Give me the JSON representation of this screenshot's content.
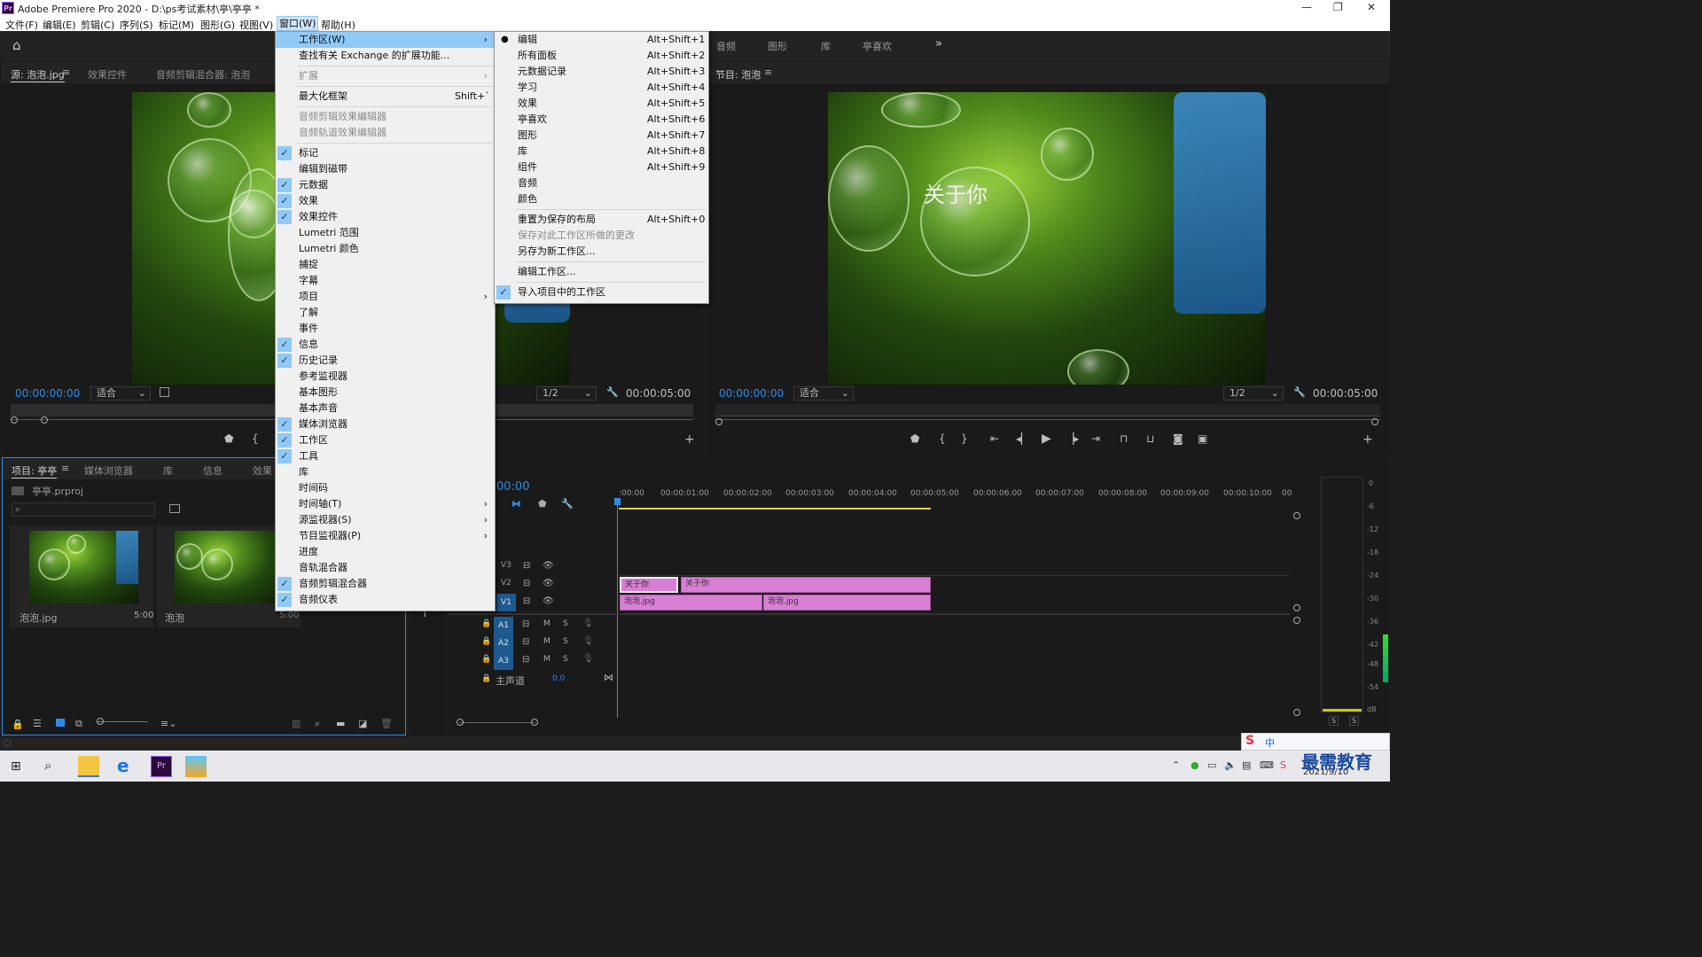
{
  "app": {
    "title": "Adobe Premiere Pro 2020 - D:\\ps考试素材\\亭\\亭亭 *",
    "window_controls": [
      "—",
      "❐",
      "✕"
    ]
  },
  "menubar": [
    "文件(F)",
    "编辑(E)",
    "剪辑(C)",
    "序列(S)",
    "标记(M)",
    "图形(G)",
    "视图(V)",
    "窗口(W)",
    "帮助(H)"
  ],
  "workspace_tabs": [
    "音频",
    "图形",
    "库",
    "亭喜欢"
  ],
  "workspace_more": "»",
  "source_panel": {
    "tabs": [
      "源: 泡泡.jpg",
      "效果控件",
      "音频剪辑混合器: 泡泡"
    ],
    "timecode": "00:00:00:00",
    "fit": "适合",
    "resolution": "1/2",
    "duration": "00:00:05:00"
  },
  "program_panel": {
    "title": "节目: 泡泡",
    "timecode": "00:00:00:00",
    "fit": "适合",
    "resolution": "1/2",
    "duration": "00:00:05:00",
    "overlay_text": "关于你"
  },
  "project_panel": {
    "tabs": [
      "项目: 亭亭",
      "媒体浏览器",
      "库",
      "信息",
      "效果"
    ],
    "file": "亭亭.prproj",
    "items": [
      {
        "name": "泡泡.jpg",
        "duration": "5:00"
      },
      {
        "name": "泡泡",
        "duration": "5:00"
      }
    ]
  },
  "timeline": {
    "timecode": "00:00",
    "ruler": [
      ":00:00",
      "00:00:01:00",
      "00:00:02:00",
      "00:00:03:00",
      "00:00:04:00",
      "00:00:05:00",
      "00:00:06:00",
      "00:00:07:00",
      "00:00:08:00",
      "00:00:09:00",
      "00:00:10:00",
      "00"
    ],
    "video_tracks": [
      "V3",
      "V2",
      "V1"
    ],
    "audio_tracks": [
      "A1",
      "A2",
      "A3"
    ],
    "master_label": "主声道",
    "master_value": "0.0",
    "track_buttons": {
      "m": "M",
      "s": "S"
    },
    "clips_v2": [
      "关于你",
      "关于你"
    ],
    "clips_v1": [
      "泡泡.jpg",
      "泡泡.jpg"
    ]
  },
  "meter": {
    "scale": [
      "0",
      "-6",
      "-12",
      "-18",
      "-24",
      "-30",
      "-36",
      "-42",
      "-48",
      "-54",
      "dB"
    ],
    "solo": [
      "S",
      "S"
    ]
  },
  "window_menu": [
    {
      "label": "工作区(W)",
      "submenu": true,
      "highlight": true
    },
    {
      "label": "查找有关 Exchange 的扩展功能..."
    },
    {
      "sep": true
    },
    {
      "label": "扩展",
      "submenu": true,
      "disabled": true
    },
    {
      "sep": true
    },
    {
      "label": "最大化框架",
      "shortcut": "Shift+`"
    },
    {
      "sep": true
    },
    {
      "label": "音频剪辑效果编辑器",
      "disabled": true
    },
    {
      "label": "音频轨道效果编辑器",
      "disabled": true
    },
    {
      "sep": true
    },
    {
      "label": "标记",
      "checked": true
    },
    {
      "label": "编辑到磁带"
    },
    {
      "label": "元数据",
      "checked": true
    },
    {
      "label": "效果",
      "checked": true
    },
    {
      "label": "效果控件",
      "checked": true
    },
    {
      "label": "Lumetri 范围"
    },
    {
      "label": "Lumetri 颜色"
    },
    {
      "label": "捕捉"
    },
    {
      "label": "字幕"
    },
    {
      "label": "项目",
      "submenu": true
    },
    {
      "label": "了解"
    },
    {
      "label": "事件"
    },
    {
      "label": "信息",
      "checked": true
    },
    {
      "label": "历史记录",
      "checked": true
    },
    {
      "label": "参考监视器"
    },
    {
      "label": "基本图形"
    },
    {
      "label": "基本声音"
    },
    {
      "label": "媒体浏览器",
      "checked": true
    },
    {
      "label": "工作区",
      "checked": true
    },
    {
      "label": "工具",
      "checked": true
    },
    {
      "label": "库"
    },
    {
      "label": "时间码"
    },
    {
      "label": "时间轴(T)",
      "submenu": true
    },
    {
      "label": "源监视器(S)",
      "submenu": true
    },
    {
      "label": "节目监视器(P)",
      "submenu": true
    },
    {
      "label": "进度"
    },
    {
      "label": "音轨混合器"
    },
    {
      "label": "音频剪辑混合器",
      "checked": true
    },
    {
      "label": "音频仪表",
      "checked": true
    }
  ],
  "workspace_submenu": [
    {
      "label": "编辑",
      "shortcut": "Alt+Shift+1",
      "bullet": true
    },
    {
      "label": "所有面板",
      "shortcut": "Alt+Shift+2"
    },
    {
      "label": "元数据记录",
      "shortcut": "Alt+Shift+3"
    },
    {
      "label": "学习",
      "shortcut": "Alt+Shift+4"
    },
    {
      "label": "效果",
      "shortcut": "Alt+Shift+5"
    },
    {
      "label": "亭喜欢",
      "shortcut": "Alt+Shift+6"
    },
    {
      "label": "图形",
      "shortcut": "Alt+Shift+7"
    },
    {
      "label": "库",
      "shortcut": "Alt+Shift+8"
    },
    {
      "label": "组件",
      "shortcut": "Alt+Shift+9"
    },
    {
      "label": "音频"
    },
    {
      "label": "颜色"
    },
    {
      "sep": true
    },
    {
      "label": "重置为保存的布局",
      "shortcut": "Alt+Shift+0"
    },
    {
      "label": "保存对此工作区所做的更改",
      "disabled": true
    },
    {
      "label": "另存为新工作区..."
    },
    {
      "sep": true
    },
    {
      "label": "编辑工作区..."
    },
    {
      "sep": true
    },
    {
      "label": "导入项目中的工作区",
      "checked": true
    }
  ],
  "taskbar": {
    "tray": "中",
    "date": "2021/9/10",
    "watermark": "最需教育"
  },
  "colors": {
    "accent": "#2d8ceb",
    "clip": "#d97ed5",
    "menu_highlight": "#91c9f7"
  }
}
